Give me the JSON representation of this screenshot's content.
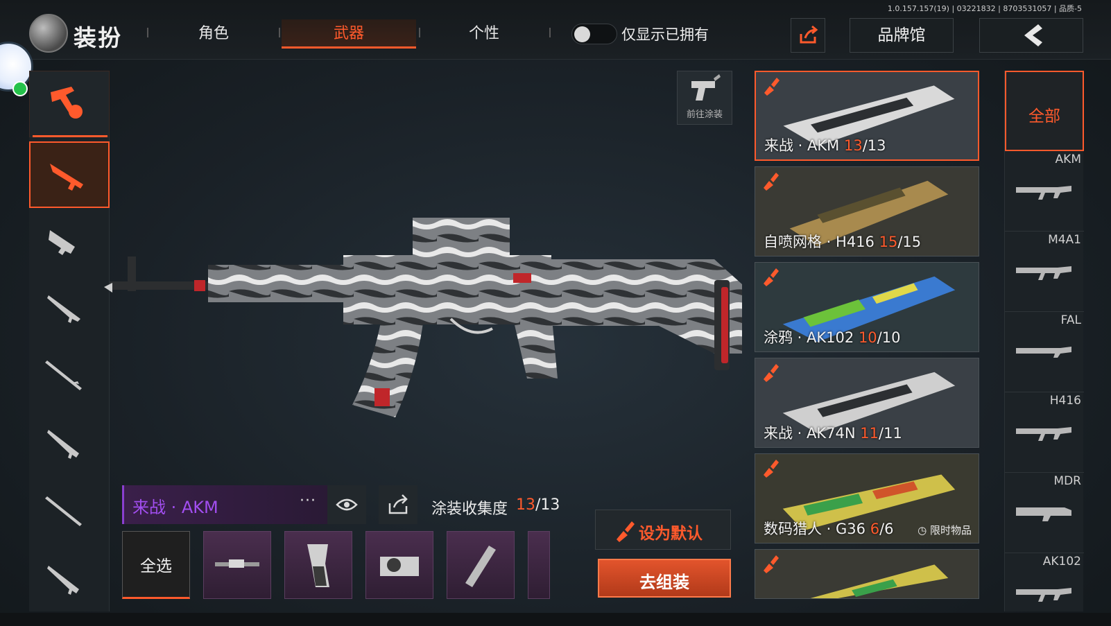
{
  "version": "1.0.157.157(19) | 03221832 | 8703531057 | 品质-5",
  "header": {
    "title": "装扮",
    "tabs": [
      {
        "label": "角色"
      },
      {
        "label": "武器"
      },
      {
        "label": "个性"
      }
    ],
    "owned_only_label": "仅显示已拥有",
    "brand_hall_label": "品牌馆"
  },
  "display": {
    "goto_skin_label": "前往涂装"
  },
  "current": {
    "skin_name": "来战 · AKM",
    "more": "···",
    "collection_label": "涂装收集度",
    "collection_owned": "13",
    "collection_total": "/13"
  },
  "parts": {
    "select_all_label": "全选"
  },
  "actions": {
    "set_default_label": "设为默认",
    "assemble_label": "去组装"
  },
  "skins": [
    {
      "name": "来战 · AKM",
      "owned": "13",
      "total": "/13",
      "palette": "bw"
    },
    {
      "name": "自喷网格 · H416",
      "owned": "15",
      "total": "/15",
      "palette": "tan"
    },
    {
      "name": "涂鸦 · AK102",
      "owned": "10",
      "total": "/10",
      "palette": "graffiti"
    },
    {
      "name": "来战 · AK74N",
      "owned": "11",
      "total": "/11",
      "palette": "bw"
    },
    {
      "name": "数码猎人 · G36",
      "owned": "6",
      "total": "/6",
      "palette": "digital",
      "limited": "限时物品"
    },
    {
      "name": "",
      "owned": "",
      "total": "",
      "palette": "digital2"
    }
  ],
  "filters": {
    "all_label": "全部",
    "items": [
      "AKM",
      "M4A1",
      "FAL",
      "H416",
      "MDR",
      "AK102"
    ]
  },
  "colors": {
    "accent": "#ff5a2c",
    "purple": "#a24ef0"
  }
}
